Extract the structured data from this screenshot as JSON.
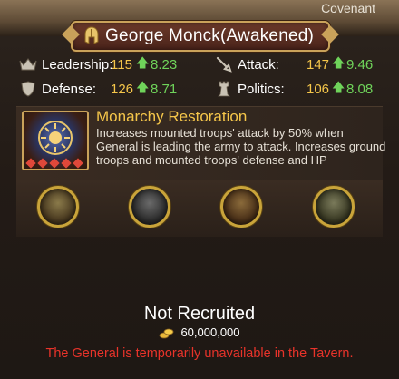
{
  "header": {
    "tag": "Covenant",
    "general_name": "George Monck(Awakened)"
  },
  "stats": {
    "leadership": {
      "label": "Leadership:",
      "value": "115",
      "bonus": "8.23"
    },
    "attack": {
      "label": "Attack:",
      "value": "147",
      "bonus": "9.46"
    },
    "defense": {
      "label": "Defense:",
      "value": "126",
      "bonus": "8.71"
    },
    "politics": {
      "label": "Politics:",
      "value": "106",
      "bonus": "8.08"
    }
  },
  "skill": {
    "title": "Monarchy Restoration",
    "description": "Increases mounted troops' attack by 50% when General is leading the army to attack. Increases ground troops and mounted troops' defense and HP",
    "stars": 5
  },
  "troops": [
    {
      "name": "troop-1-icon"
    },
    {
      "name": "troop-2-icon"
    },
    {
      "name": "troop-3-icon"
    },
    {
      "name": "troop-4-icon"
    }
  ],
  "recruit": {
    "status": "Not Recruited",
    "cost": "60,000,000",
    "warning": "The General is temporarily unavailable in the Tavern."
  },
  "colors": {
    "accent_gold": "#f5c64a",
    "bonus_green": "#6fd35a",
    "warning_red": "#e8332a",
    "frame_gold": "#c9a25a"
  }
}
